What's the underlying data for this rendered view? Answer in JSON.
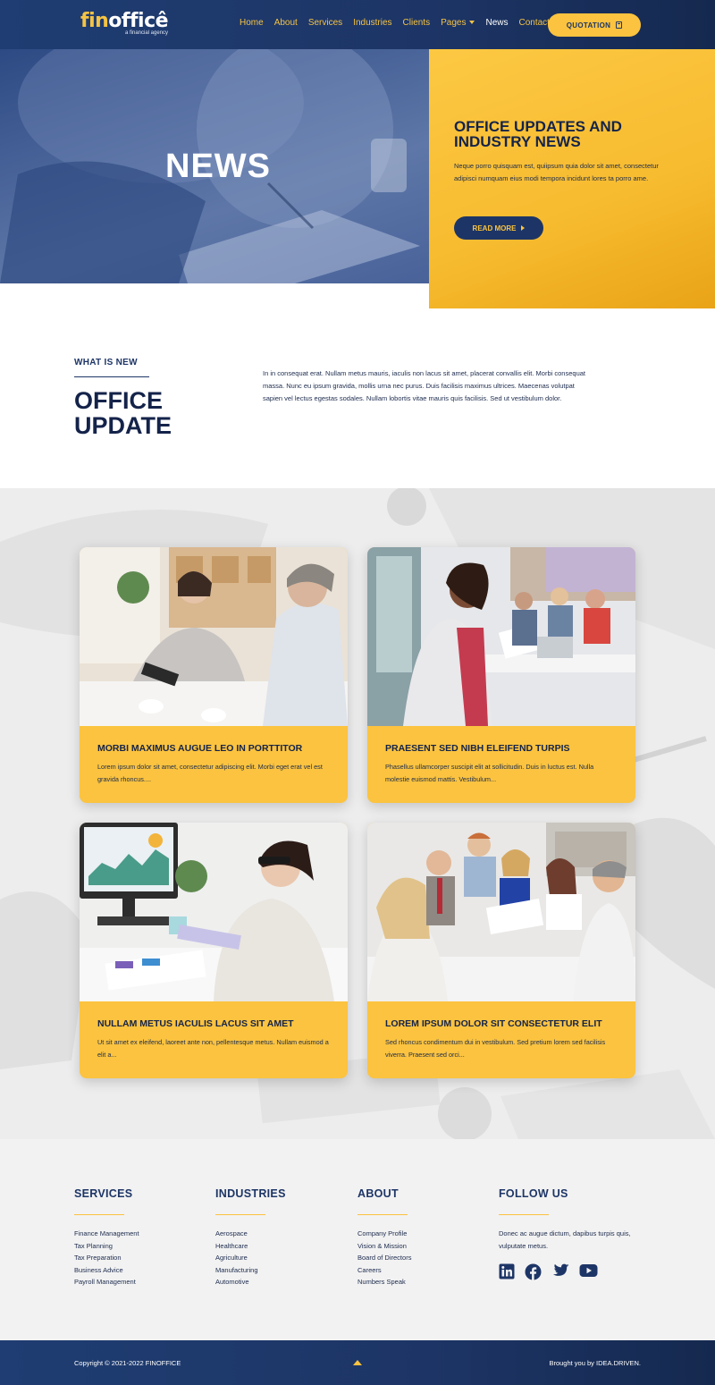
{
  "header": {
    "logo_fin": "fin",
    "logo_office": "officê",
    "logo_tagline": "a financial agency",
    "nav": [
      {
        "label": "Home"
      },
      {
        "label": "About"
      },
      {
        "label": "Services"
      },
      {
        "label": "Industries"
      },
      {
        "label": "Clients"
      },
      {
        "label": "Pages"
      },
      {
        "label": "News"
      },
      {
        "label": "Contact"
      }
    ],
    "quotation_label": "QUOTATION"
  },
  "hero": {
    "title": "NEWS",
    "card_title": "OFFICE UPDATES AND INDUSTRY NEWS",
    "card_text": "Neque porro quisquam est, quiipsum quia dolor sit amet, consectetur adipisci numquam eius modi tempora incidunt lores ta porro ame.",
    "read_more": "READ MORE"
  },
  "intro": {
    "kicker": "WHAT IS NEW",
    "heading_line1": "OFFICE",
    "heading_line2": "UPDATE",
    "text": "In in consequat erat. Nullam metus mauris, iaculis non lacus sit amet, placerat convallis elit. Morbi consequat massa. Nunc eu ipsum gravida, mollis urna nec purus. Duis facilisis maximus ultrices. Maecenas volutpat sapien vel lectus egestas sodales. Nullam lobortis vitae mauris quis facilisis. Sed ut vestibulum dolor."
  },
  "cards": [
    {
      "title": "MORBI MAXIMUS AUGUE LEO IN PORTTITOR",
      "text": "Lorem ipsum dolor sit amet, consectetur adipiscing elit. Morbi eget erat vel est gravida rhoncus...."
    },
    {
      "title": "PRAESENT SED NIBH ELEIFEND TURPIS",
      "text": "Phasellus ullamcorper suscipit elit at sollicitudin. Duis in luctus est. Nulla molestie euismod mattis. Vestibulum..."
    },
    {
      "title": "NULLAM METUS IACULIS LACUS SIT AMET",
      "text": "Ut sit amet ex eleifend, laoreet ante non, pellentesque metus. Nullam euismod a elit a..."
    },
    {
      "title": "LOREM IPSUM DOLOR SIT CONSECTETUR ELIT",
      "text": "Sed rhoncus condimentum dui in vestibulum. Sed pretium lorem sed facilisis viverra. Praesent sed orci..."
    }
  ],
  "footer": {
    "services": {
      "heading": "SERVICES",
      "items": [
        "Finance Management",
        "Tax Planning",
        "Tax Preparation",
        "Business Advice",
        "Payroll Management"
      ]
    },
    "industries": {
      "heading": "INDUSTRIES",
      "items": [
        "Aerospace",
        "Healthcare",
        "Agriculture",
        "Manufacturing",
        "Automotive"
      ]
    },
    "about": {
      "heading": "ABOUT",
      "items": [
        "Company Profile",
        "Vision & Mission",
        "Board of Directors",
        "Careers",
        "Numbers Speak"
      ]
    },
    "follow": {
      "heading": "FOLLOW US",
      "text": "Donec ac augue dictum, dapibus turpis quis, vulputate metus.",
      "icons": [
        "linkedin-icon",
        "facebook-icon",
        "twitter-icon",
        "youtube-icon"
      ]
    },
    "copyright": "Copyright © 2021-2022 FINOFFICE",
    "brought": "Brought you by IDEA.DRIVEN."
  },
  "colors": {
    "navy": "#1d3566",
    "gold": "#fbc33f",
    "dark_text": "#14234a"
  }
}
